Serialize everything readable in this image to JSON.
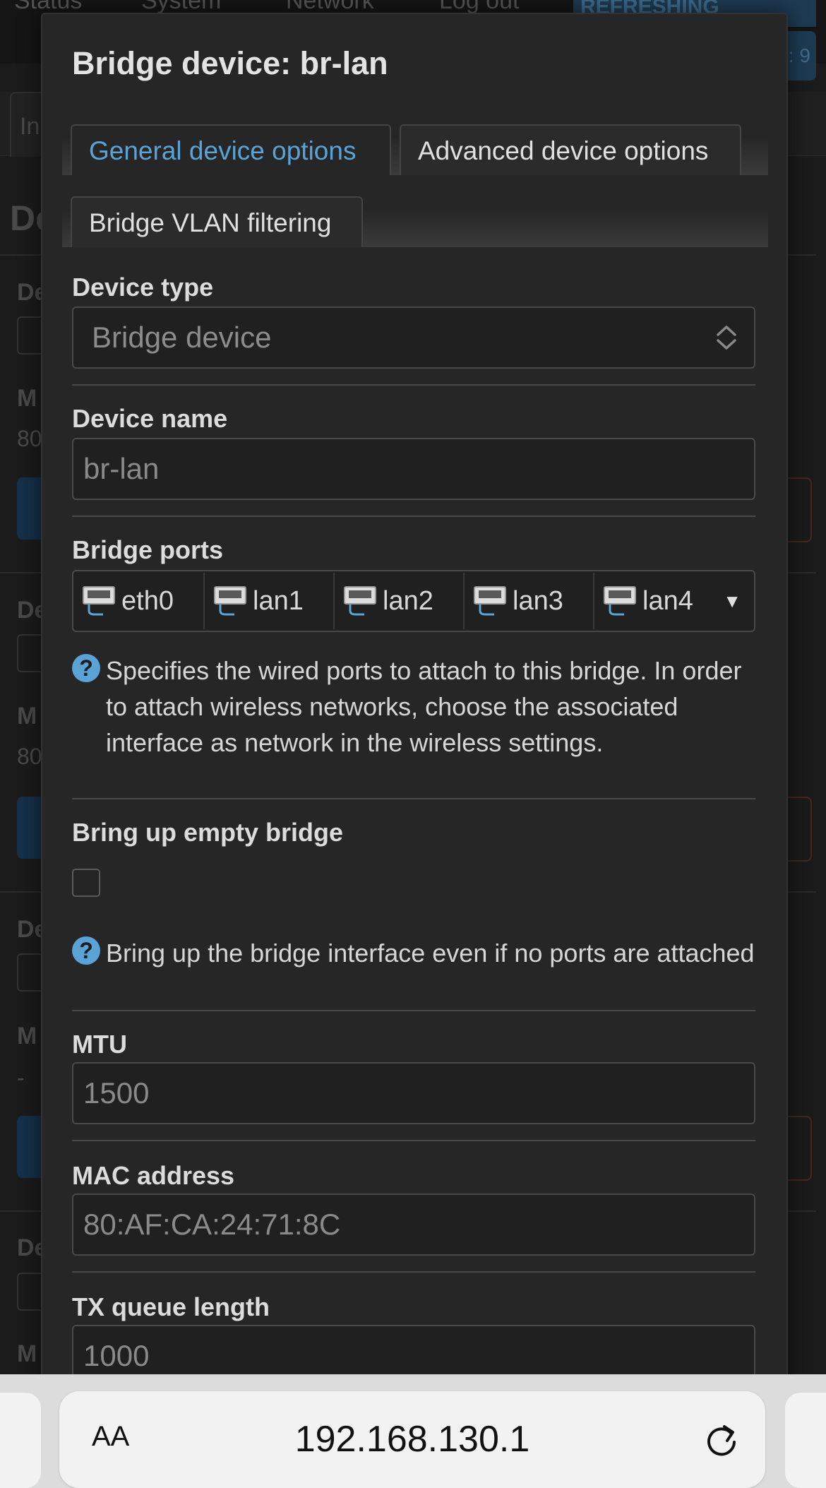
{
  "background": {
    "nav_items": [
      "Status",
      "System",
      "Network",
      "Log out"
    ],
    "refresh_badge": "REFRESHING",
    "count_badge": ": 9",
    "side_letters": [
      "In",
      "De",
      "De",
      "M",
      "80",
      "De",
      "M",
      "80",
      "De",
      "M",
      "-",
      "De",
      "M"
    ]
  },
  "modal": {
    "title": "Bridge device: br-lan",
    "tabs": [
      {
        "label": "General device options",
        "active": true
      },
      {
        "label": "Advanced device options",
        "active": false
      },
      {
        "label": "Bridge VLAN filtering",
        "active": false
      }
    ],
    "device_type": {
      "label": "Device type",
      "value": "Bridge device"
    },
    "device_name": {
      "label": "Device name",
      "placeholder": "br-lan"
    },
    "bridge_ports": {
      "label": "Bridge ports",
      "ports": [
        "eth0",
        "lan1",
        "lan2",
        "lan3",
        "lan4"
      ],
      "help": "Specifies the wired ports to attach to this bridge. In order to attach wireless networks, choose the associated interface as network in the wireless settings."
    },
    "empty_bridge": {
      "label": "Bring up empty bridge",
      "checked": false,
      "help": "Bring up the bridge interface even if no ports are attached"
    },
    "mtu": {
      "label": "MTU",
      "placeholder": "1500"
    },
    "mac": {
      "label": "MAC address",
      "placeholder": "80:AF:CA:24:71:8C"
    },
    "txqueue": {
      "label": "TX queue length",
      "placeholder": "1000"
    }
  },
  "browser": {
    "aa_label": "AA",
    "url": "192.168.130.1",
    "reload_icon": "reload-icon"
  },
  "colors": {
    "accent": "#5aa3d6",
    "modal_bg": "#262626",
    "page_bg": "#1b1b1b"
  }
}
